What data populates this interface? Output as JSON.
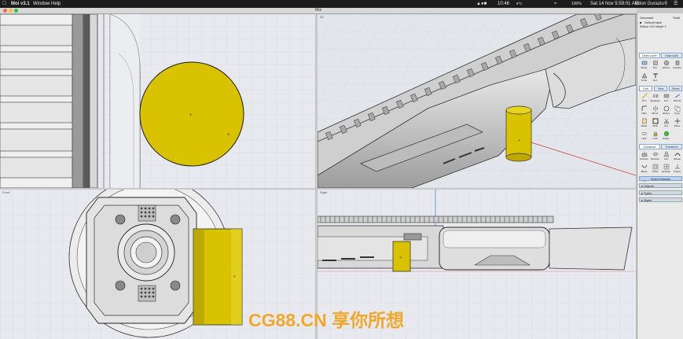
{
  "menubar": {
    "app": "Moi v3.1",
    "window": "Window",
    "help": "Help",
    "clock": "10:46 ",
    "battery": "100%",
    "datetime": "Sat 14 Nov 5:59:01 AM",
    "user": "Edon Guraziu",
    "temp": "9°C"
  },
  "window": {
    "title": "Moi"
  },
  "views": {
    "front": "Front",
    "right": "Right",
    "perspective": "3D"
  },
  "panel": {
    "object_name": "Unnamed",
    "solid": "Solid",
    "style": "Default style",
    "details": "Radius: 0.51 Height: 2",
    "tabs_draw": [
      "Draw curve",
      "Draw solid"
    ],
    "solid_tools": [
      "Plane",
      "Box",
      "Sphere",
      "Cylinder",
      "Cone",
      "Text"
    ],
    "tabs_edit": [
      "Edit",
      "View",
      "Select"
    ],
    "edit_tools": [
      "Trim",
      "Separate",
      "Join",
      "Extend",
      "Fillet",
      "Mirror",
      "History",
      "Copy",
      "Paste",
      "Shell",
      "Cut",
      "Move",
      "Hide",
      "Lock",
      "Delete"
    ],
    "tabs_construct": [
      "Construct",
      "Transform"
    ],
    "construct_tools": [
      "Extrude",
      "Revolve",
      "Loft",
      "Sweep",
      "Blend",
      "Offset",
      "Network",
      "Project",
      "Boolean"
    ],
    "scene_browser": "Scene browser",
    "sections": [
      "Objects",
      "Types",
      "Styles"
    ]
  },
  "watermark": {
    "text": "CG88.CN 享你所想"
  },
  "colors": {
    "accent": "#d9c200",
    "selection": "#8aa6c8",
    "background": "#e4e6ea"
  }
}
